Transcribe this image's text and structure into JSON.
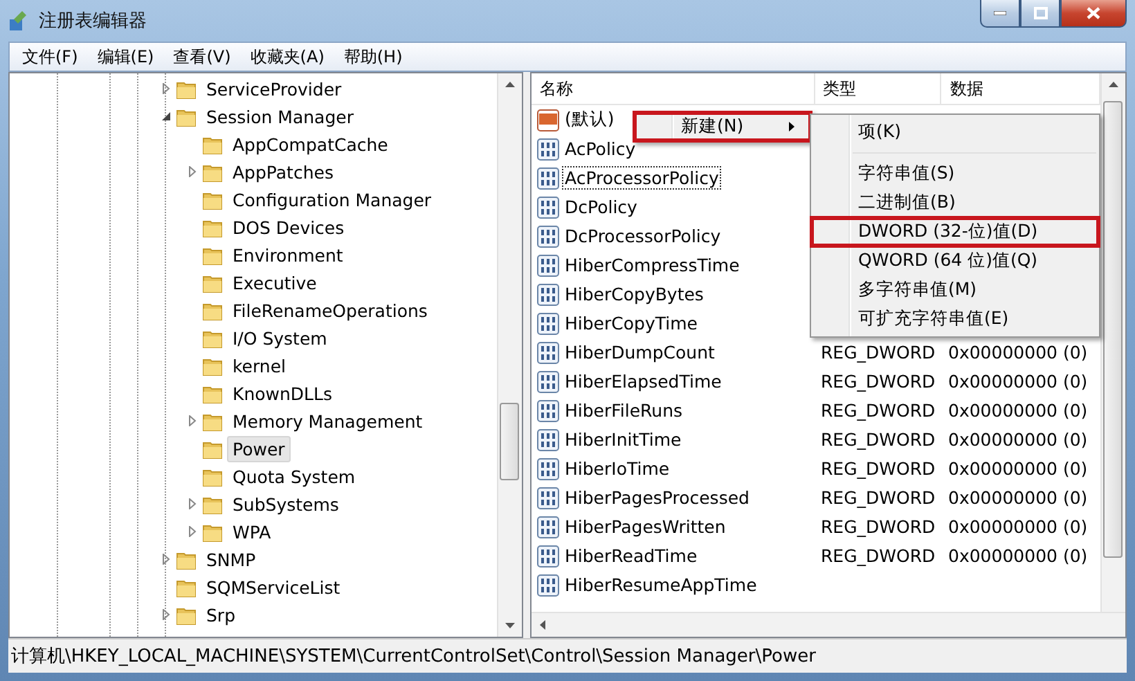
{
  "window": {
    "title": "注册表编辑器"
  },
  "menu": [
    "文件(F)",
    "编辑(E)",
    "查看(V)",
    "收藏夹(A)",
    "帮助(H)"
  ],
  "tree": [
    {
      "label": "ServiceProvider",
      "expanded": false,
      "selected": false
    },
    {
      "label": "Session Manager",
      "expanded": true,
      "selected": false,
      "children": [
        {
          "label": "AppCompatCache",
          "selected": false
        },
        {
          "label": "AppPatches",
          "expanded": false,
          "selected": false
        },
        {
          "label": "Configuration Manager",
          "selected": false
        },
        {
          "label": "DOS Devices",
          "selected": false
        },
        {
          "label": "Environment",
          "selected": false
        },
        {
          "label": "Executive",
          "selected": false
        },
        {
          "label": "FileRenameOperations",
          "selected": false
        },
        {
          "label": "I/O System",
          "selected": false
        },
        {
          "label": "kernel",
          "selected": false
        },
        {
          "label": "KnownDLLs",
          "selected": false
        },
        {
          "label": "Memory Management",
          "expanded": false,
          "selected": false
        },
        {
          "label": "Power",
          "selected": true
        },
        {
          "label": "Quota System",
          "selected": false
        },
        {
          "label": "SubSystems",
          "expanded": false,
          "selected": false
        },
        {
          "label": "WPA",
          "expanded": false,
          "selected": false
        }
      ]
    },
    {
      "label": "SNMP",
      "expanded": false,
      "selected": false
    },
    {
      "label": "SQMServiceList",
      "selected": false
    },
    {
      "label": "Srp",
      "expanded": false,
      "selected": false
    }
  ],
  "table": {
    "columns": [
      "名称",
      "类型",
      "数据"
    ],
    "rows": [
      {
        "kind": "string",
        "name": "(默认)",
        "focused": false
      },
      {
        "kind": "dword",
        "name": "AcPolicy",
        "focused": false
      },
      {
        "kind": "dword",
        "name": "AcProcessorPolicy",
        "focused": true
      },
      {
        "kind": "dword",
        "name": "DcPolicy",
        "focused": false
      },
      {
        "kind": "dword",
        "name": "DcProcessorPolicy",
        "focused": false
      },
      {
        "kind": "dword",
        "name": "HiberCompressTime",
        "focused": false
      },
      {
        "kind": "dword",
        "name": "HiberCopyBytes",
        "focused": false
      },
      {
        "kind": "dword",
        "name": "HiberCopyTime",
        "focused": false
      },
      {
        "kind": "dword",
        "name": "HiberDumpCount",
        "type": "REG_DWORD",
        "data": "0x00000000 (0)",
        "focused": false
      },
      {
        "kind": "dword",
        "name": "HiberElapsedTime",
        "type": "REG_DWORD",
        "data": "0x00000000 (0)",
        "focused": false
      },
      {
        "kind": "dword",
        "name": "HiberFileRuns",
        "type": "REG_DWORD",
        "data": "0x00000000 (0)",
        "focused": false
      },
      {
        "kind": "dword",
        "name": "HiberInitTime",
        "type": "REG_DWORD",
        "data": "0x00000000 (0)",
        "focused": false
      },
      {
        "kind": "dword",
        "name": "HiberIoTime",
        "type": "REG_DWORD",
        "data": "0x00000000 (0)",
        "focused": false
      },
      {
        "kind": "dword",
        "name": "HiberPagesProcessed",
        "type": "REG_DWORD",
        "data": "0x00000000 (0)",
        "focused": false
      },
      {
        "kind": "dword",
        "name": "HiberPagesWritten",
        "type": "REG_DWORD",
        "data": "0x00000000 (0)",
        "focused": false
      },
      {
        "kind": "dword",
        "name": "HiberReadTime",
        "type": "REG_DWORD",
        "data": "0x00000000 (0)",
        "focused": false
      },
      {
        "kind": "dword",
        "name": "HiberResumeAppTime",
        "focused": false
      }
    ]
  },
  "context_menu": {
    "items": [
      {
        "label": "新建(N)",
        "highlighted": true,
        "submenu": true
      }
    ]
  },
  "submenu": {
    "items": [
      {
        "kind": "item",
        "label": "项(K)",
        "highlighted": false
      },
      {
        "kind": "separator"
      },
      {
        "kind": "item",
        "label": "字符串值(S)",
        "highlighted": false
      },
      {
        "kind": "item",
        "label": "二进制值(B)",
        "highlighted": false
      },
      {
        "kind": "item",
        "label": "DWORD (32-位)值(D)",
        "highlighted": true
      },
      {
        "kind": "item",
        "label": "QWORD (64 位)值(Q)",
        "highlighted": false
      },
      {
        "kind": "item",
        "label": "多字符串值(M)",
        "highlighted": false
      },
      {
        "kind": "item",
        "label": "可扩充字符串值(E)",
        "highlighted": false
      }
    ]
  },
  "status_bar": "计算机\\HKEY_LOCAL_MACHINE\\SYSTEM\\CurrentControlSet\\Control\\Session Manager\\Power"
}
